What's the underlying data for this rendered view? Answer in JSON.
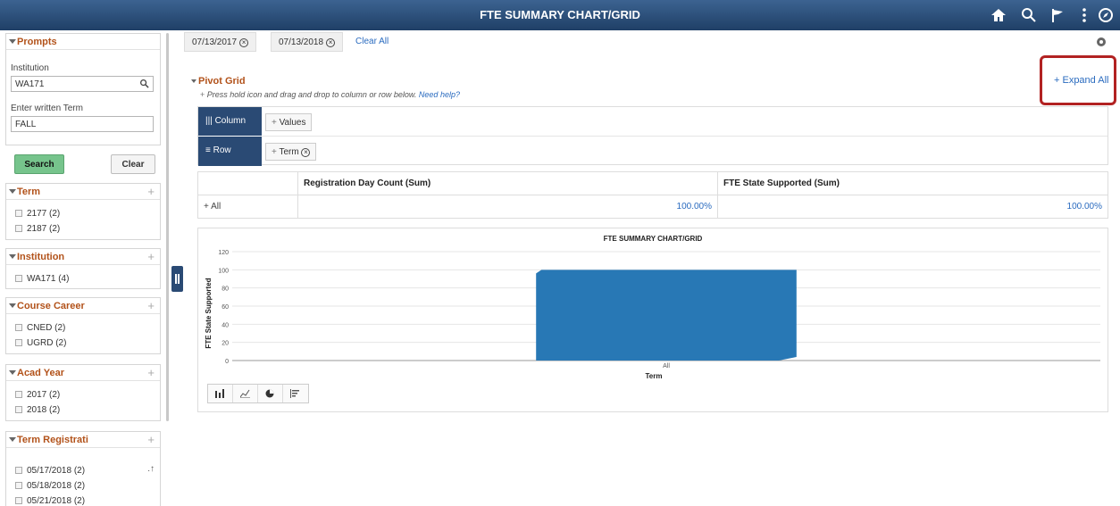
{
  "header": {
    "title": "FTE SUMMARY CHART/GRID"
  },
  "prompts": {
    "title": "Prompts",
    "institution_label": "Institution",
    "institution_value": "WA171",
    "term_label": "Enter written Term",
    "term_value": "FALL",
    "search_label": "Search",
    "clear_label": "Clear"
  },
  "facets": [
    {
      "title": "Term",
      "options": [
        "2177 (2)",
        "2187 (2)"
      ]
    },
    {
      "title": "Institution",
      "options": [
        "WA171 (4)"
      ]
    },
    {
      "title": "Course Career",
      "options": [
        "CNED (2)",
        "UGRD (2)"
      ]
    },
    {
      "title": "Acad Year",
      "options": [
        "2017 (2)",
        "2018 (2)"
      ]
    },
    {
      "title": "Term Registrati",
      "options": [
        "05/17/2018 (2)",
        "05/18/2018 (2)",
        "05/21/2018 (2)"
      ]
    }
  ],
  "filters": {
    "chips": [
      "07/13/2017",
      "07/13/2018"
    ],
    "clear_all": "Clear All"
  },
  "pivot": {
    "title": "Pivot Grid",
    "help_text": "Press hold icon and drag and drop to column or row below.",
    "help_link": "Need help?",
    "expand_all": "+ Expand All",
    "column_label": "Column",
    "column_item": "Values",
    "row_label": "Row",
    "row_item": "Term"
  },
  "grid": {
    "headers": [
      "",
      "Registration Day Count (Sum)",
      "FTE State Supported (Sum)"
    ],
    "rows": [
      {
        "label": "+ All",
        "values": [
          "100.00%",
          "100.00%"
        ]
      }
    ]
  },
  "chart_data": {
    "type": "bar",
    "title": "FTE SUMMARY CHART/GRID",
    "categories": [
      "All"
    ],
    "values": [
      100
    ],
    "xlabel": "Term",
    "ylabel": "FTE State Supported",
    "ylim": [
      0,
      120
    ],
    "yticks": [
      0,
      20,
      40,
      60,
      80,
      100,
      120
    ],
    "grid": true,
    "bar_color": "#2878b5"
  }
}
